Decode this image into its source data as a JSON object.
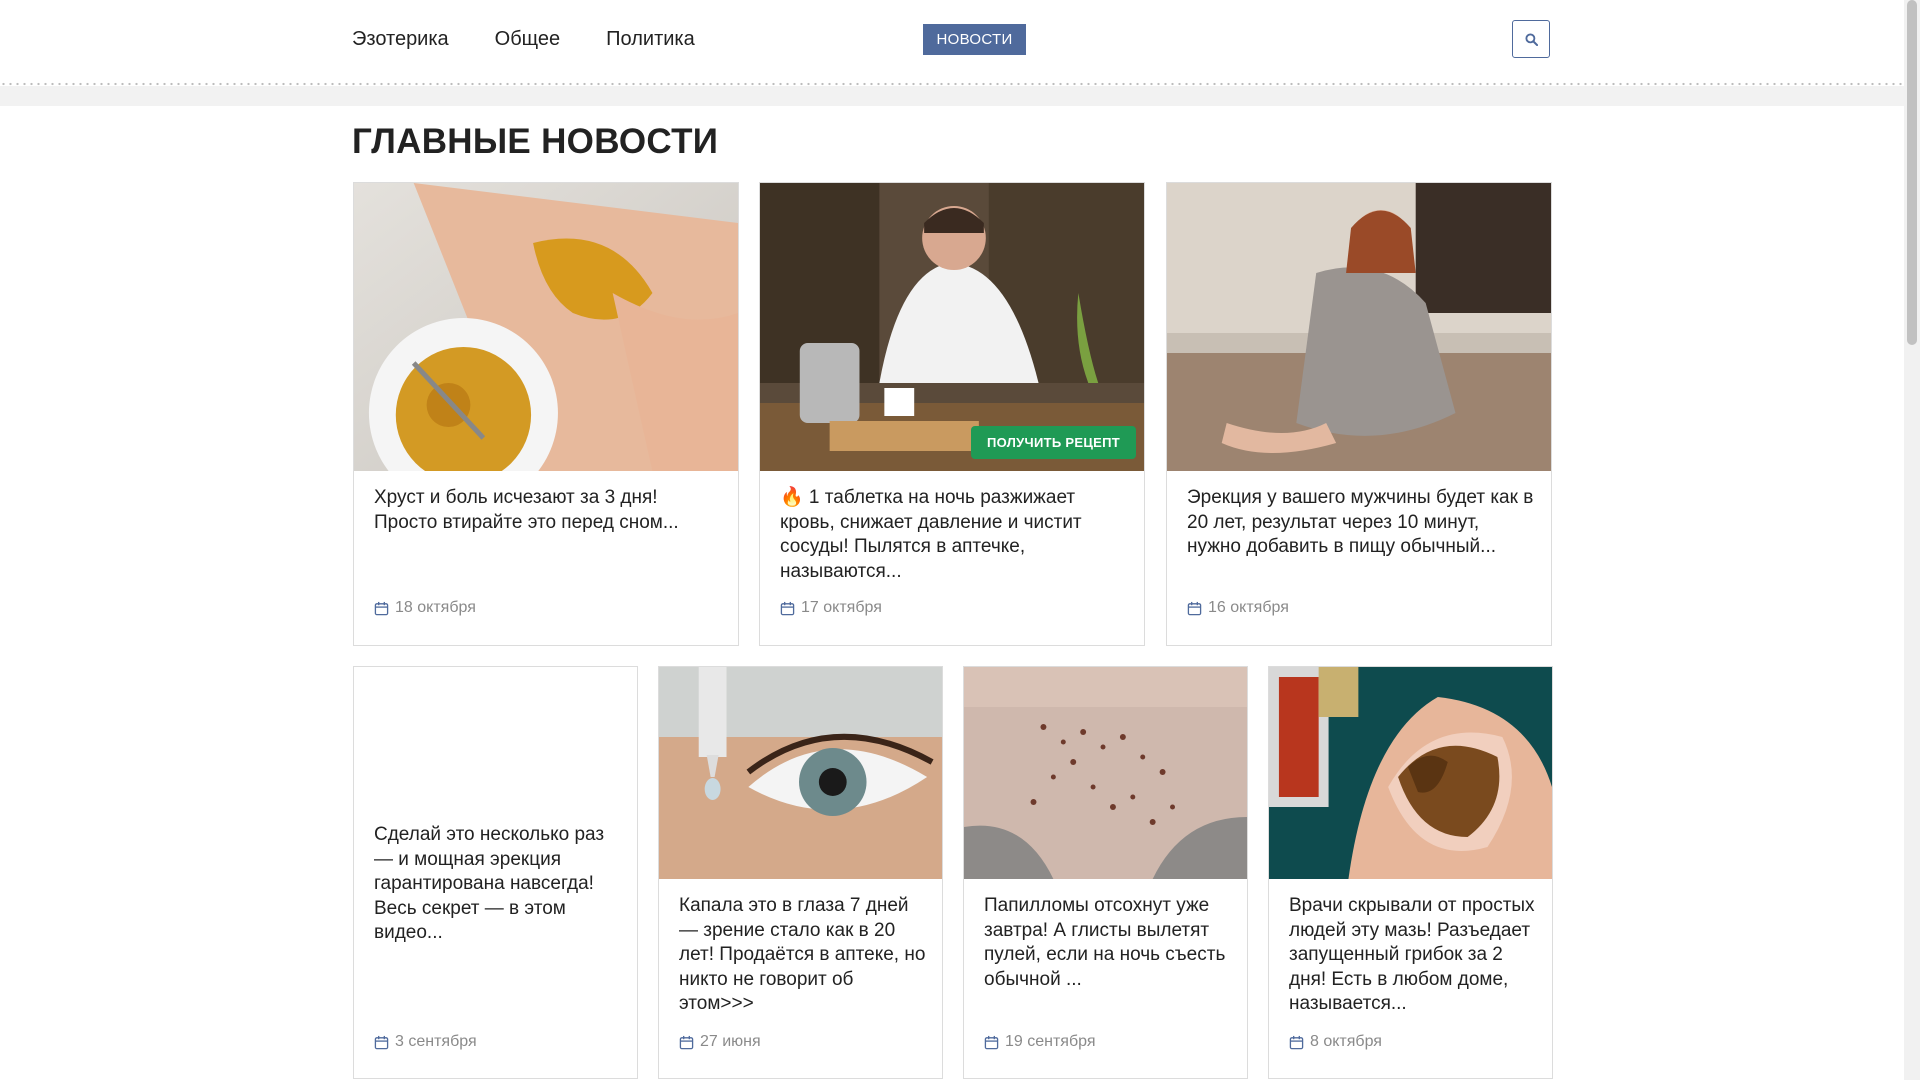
{
  "nav": {
    "items": [
      {
        "label": "Эзотерика"
      },
      {
        "label": "Общее"
      },
      {
        "label": "Политика"
      }
    ],
    "news_button": "НОВОСТИ",
    "search_icon": "search-icon"
  },
  "colors": {
    "accent": "#4f6a9c",
    "recipe_green": "#1f9a55",
    "date_icon": "#4f6a9c"
  },
  "main": {
    "title": "ГЛАВНЫЕ НОВОСТИ",
    "cards_row1": [
      {
        "title": "Хруст и боль исчезают за 3 дня! Просто втирайте это перед сном...",
        "date": "18 октября"
      },
      {
        "title": "🔥 1 таблетка на ночь разжижает кровь, снижает давление и чистит сосуды! Пылятся в аптечке, называются...",
        "date": "17 октября",
        "image_button": "ПОЛУЧИТЬ РЕЦЕПТ"
      },
      {
        "title": "Эрекция у вашего мужчины будет как в 20 лет, результат через 10 минут, нужно добавить в пищу обычный...",
        "date": "16 октября"
      }
    ],
    "cards_row2": [
      {
        "title": "Сделай это несколько раз — и мощная эрекция гарантирована навсегда! Весь секрет — в этом видео...",
        "date": "3 сентября"
      },
      {
        "title": "Капала это в глаза 7 дней — зрение стало как в 20 лет! Продаётся в аптеке, но никто не говорит об этом>>>",
        "date": "27 июня"
      },
      {
        "title": "Папилломы отсохнут уже завтра! А глисты вылетят пулей, если на ночь съесть обычной ...",
        "date": "19 сентября"
      },
      {
        "title": "Врачи скрывали от простых людей эту мазь! Разъедает запущенный грибок за 2 дня! Есть в любом доме, называется...",
        "date": "8 октября"
      }
    ]
  }
}
